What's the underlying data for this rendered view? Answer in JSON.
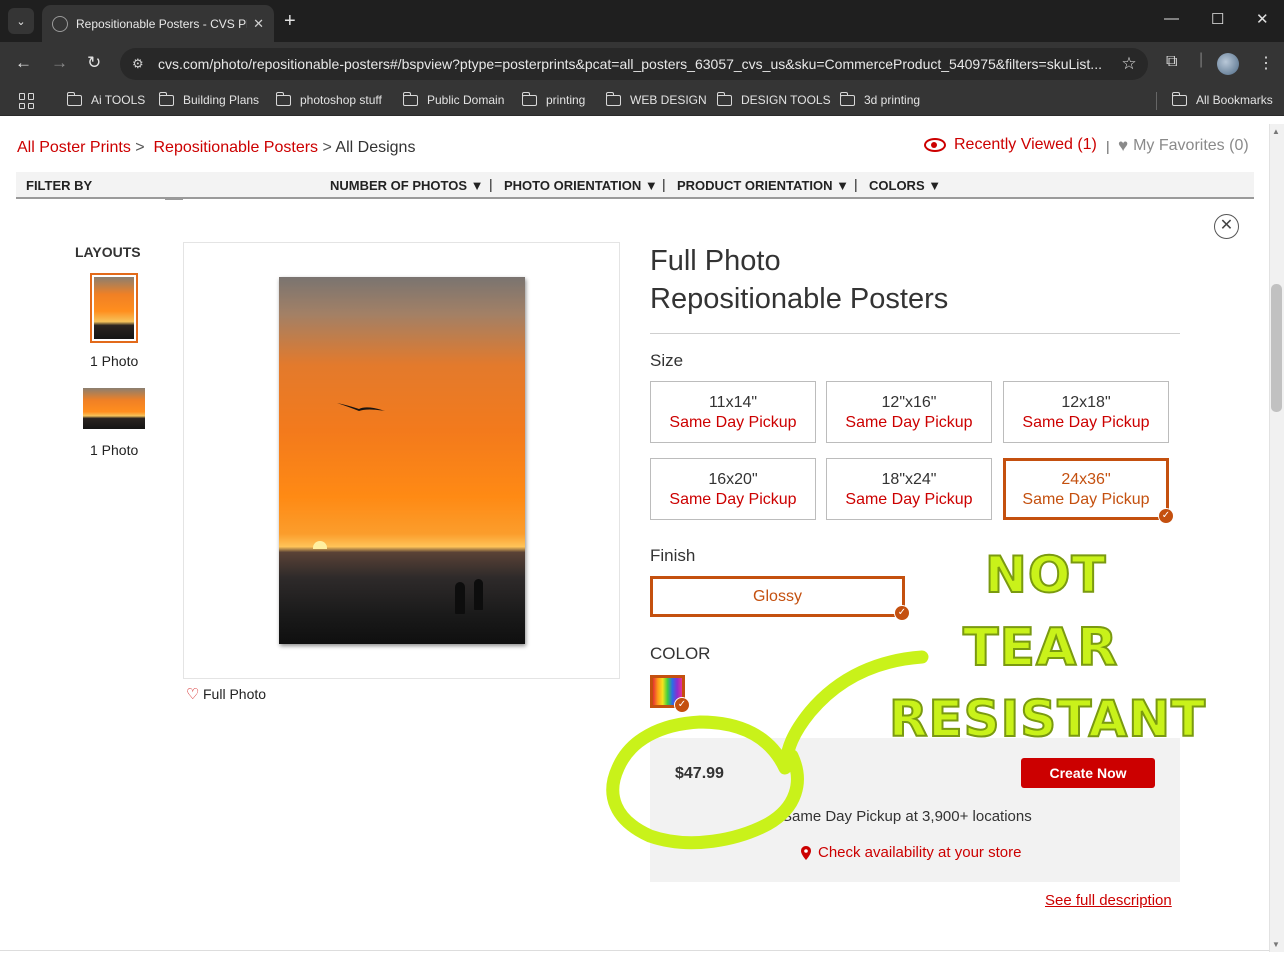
{
  "browser": {
    "tab_title": "Repositionable Posters - CVS Pl",
    "url": "cvs.com/photo/repositionable-posters#/bspview?ptype=posterprints&pcat=all_posters_63057_cvs_us&sku=CommerceProduct_540975&filters=skuList...",
    "bookmarks": [
      "Ai TOOLS",
      "Building Plans",
      "photoshop stuff",
      "Public Domain",
      "printing",
      "WEB DESIGN",
      "DESIGN TOOLS",
      "3d printing"
    ],
    "all_bookmarks": "All Bookmarks"
  },
  "breadcrumb": {
    "item1": "All Poster Prints",
    "sep1": ">",
    "item2": "Repositionable Posters",
    "sep2": ">",
    "current": "All Designs"
  },
  "header_links": {
    "recently_viewed": "Recently Viewed (1)",
    "favorites": "My Favorites (0)"
  },
  "filters": {
    "label": "FILTER BY",
    "items": [
      "NUMBER OF PHOTOS",
      "PHOTO ORIENTATION",
      "PRODUCT ORIENTATION",
      "COLORS"
    ]
  },
  "layouts": {
    "title": "LAYOUTS",
    "options": [
      {
        "label": "1 Photo",
        "orientation": "portrait",
        "selected": true
      },
      {
        "label": "1 Photo",
        "orientation": "landscape",
        "selected": false
      }
    ]
  },
  "preview": {
    "favorite_label": "Full Photo"
  },
  "product": {
    "title_line1": "Full Photo",
    "title_line2": "Repositionable Posters",
    "size_label": "Size",
    "sizes": [
      {
        "size": "11x14\"",
        "pickup": "Same Day Pickup",
        "selected": false
      },
      {
        "size": "12\"x16\"",
        "pickup": "Same Day Pickup",
        "selected": false
      },
      {
        "size": "12x18\"",
        "pickup": "Same Day Pickup",
        "selected": false
      },
      {
        "size": "16x20\"",
        "pickup": "Same Day Pickup",
        "selected": false
      },
      {
        "size": "18\"x24\"",
        "pickup": "Same Day Pickup",
        "selected": false
      },
      {
        "size": "24x36\"",
        "pickup": "Same Day Pickup",
        "selected": true
      }
    ],
    "finish_label": "Finish",
    "finish_value": "Glossy",
    "color_label": "COLOR",
    "price": "$47.99",
    "create_button": "Create Now",
    "pickup_info": "Same Day Pickup at 3,900+ locations",
    "availability_link": "Check availability at your store",
    "see_full_link": "See full description"
  },
  "annotation": {
    "line1": "NOT",
    "line2": "TEAR",
    "line3": "RESISTANT"
  },
  "colors": {
    "brand_red": "#cc0000",
    "selected_orange": "#c4500f",
    "annotation_green": "#c9f21a"
  }
}
